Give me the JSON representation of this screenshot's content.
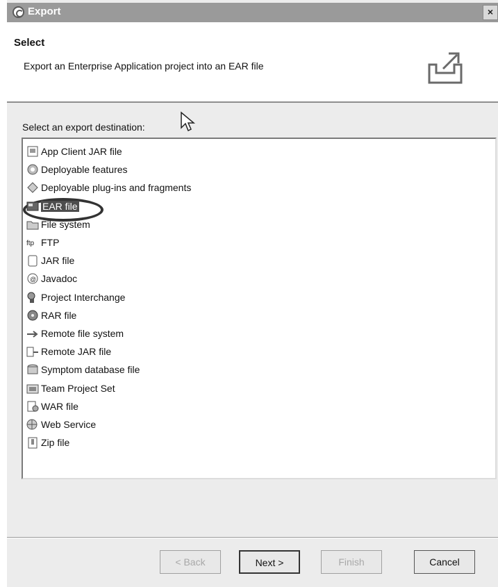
{
  "window": {
    "title": "Export",
    "close_label": "×"
  },
  "banner": {
    "title": "Select",
    "description": "Export an Enterprise Application project into an EAR file",
    "icon": "export-icon"
  },
  "destination": {
    "label": "Select an export destination:",
    "selected": "EAR file",
    "items": [
      {
        "label": "App Client JAR file",
        "icon": "app-client-jar-icon"
      },
      {
        "label": "Deployable features",
        "icon": "deployable-features-icon"
      },
      {
        "label": "Deployable plug-ins and fragments",
        "icon": "deployable-plugins-icon"
      },
      {
        "label": "EAR file",
        "icon": "ear-file-icon"
      },
      {
        "label": "File system",
        "icon": "file-system-icon"
      },
      {
        "label": "FTP",
        "icon": "ftp-icon"
      },
      {
        "label": "JAR file",
        "icon": "jar-file-icon"
      },
      {
        "label": "Javadoc",
        "icon": "javadoc-icon"
      },
      {
        "label": "Project Interchange",
        "icon": "project-interchange-icon"
      },
      {
        "label": "RAR file",
        "icon": "rar-file-icon"
      },
      {
        "label": "Remote file system",
        "icon": "remote-file-system-icon"
      },
      {
        "label": "Remote JAR file",
        "icon": "remote-jar-file-icon"
      },
      {
        "label": "Symptom database file",
        "icon": "symptom-database-icon"
      },
      {
        "label": "Team Project Set",
        "icon": "team-project-set-icon"
      },
      {
        "label": "WAR file",
        "icon": "war-file-icon"
      },
      {
        "label": "Web Service",
        "icon": "web-service-icon"
      },
      {
        "label": "Zip file",
        "icon": "zip-file-icon"
      }
    ]
  },
  "buttons": {
    "back": "< Back",
    "next": "Next >",
    "finish": "Finish",
    "cancel": "Cancel"
  },
  "colors": {
    "titlebar": "#9a9a9a",
    "selection": "#4d4d4d",
    "dialog_bg": "#ececec"
  }
}
